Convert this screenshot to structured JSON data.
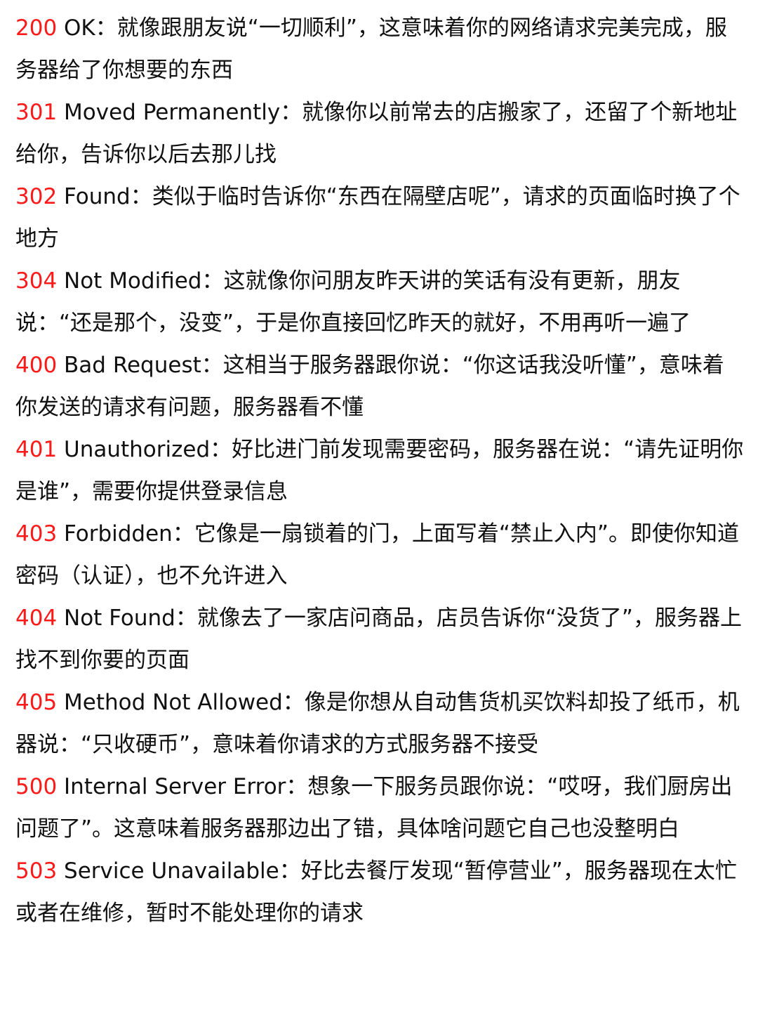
{
  "accent_color": "#ff1a1a",
  "entries": [
    {
      "code": "200",
      "text": " OK：就像跟朋友说“一切顺利”，这意味着你的网络请求完美完成，服务器给了你想要的东西"
    },
    {
      "code": "301",
      "text": " Moved Permanently：就像你以前常去的店搬家了，还留了个新地址给你，告诉你以后去那儿找"
    },
    {
      "code": "302",
      "text": " Found：类似于临时告诉你“东西在隔壁店呢”，请求的页面临时换了个地方"
    },
    {
      "code": "304",
      "text": " Not Modified：这就像你问朋友昨天讲的笑话有没有更新，朋友说：“还是那个，没变”，于是你直接回忆昨天的就好，不用再听一遍了"
    },
    {
      "code": "400",
      "text": " Bad Request：这相当于服务器跟你说：“你这话我没听懂”，意味着你发送的请求有问题，服务器看不懂"
    },
    {
      "code": "401",
      "text": " Unauthorized：好比进门前发现需要密码，服务器在说：“请先证明你是谁”，需要你提供登录信息"
    },
    {
      "code": "403",
      "text": " Forbidden：它像是一扇锁着的门，上面写着“禁止入内”。即使你知道密码（认证），也不允许进入"
    },
    {
      "code": "404",
      "text": " Not Found：就像去了一家店问商品，店员告诉你“没货了”，服务器上找不到你要的页面"
    },
    {
      "code": "405",
      "text": " Method Not Allowed：像是你想从自动售货机买饮料却投了纸币，机器说：“只收硬币”，意味着你请求的方式服务器不接受"
    },
    {
      "code": "500",
      "text": " Internal Server Error：想象一下服务员跟你说：“哎呀，我们厨房出问题了”。这意味着服务器那边出了错，具体啥问题它自己也没整明白"
    },
    {
      "code": "503",
      "text": " Service Unavailable：好比去餐厅发现“暂停营业”，服务器现在太忙或者在维修，暂时不能处理你的请求"
    }
  ]
}
